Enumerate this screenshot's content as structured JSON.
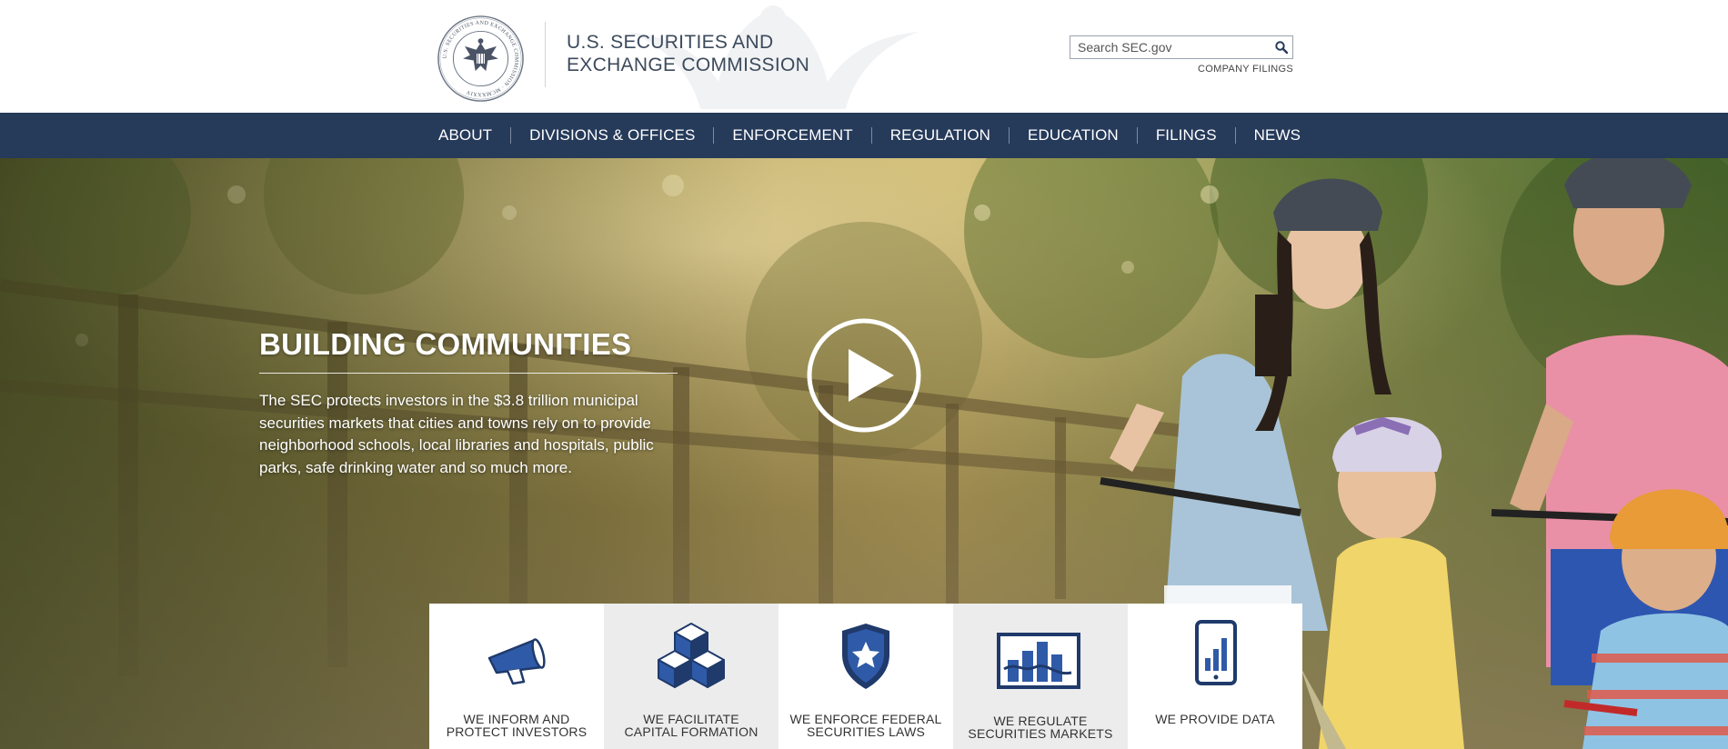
{
  "header": {
    "seal_text": "U.S. SECURITIES AND EXCHANGE COMMISSION · MCMXXXIV",
    "agency_name": "U.S. SECURITIES AND EXCHANGE COMMISSION",
    "search": {
      "placeholder": "Search SEC.gov",
      "value": ""
    },
    "company_filings_label": "COMPANY FILINGS"
  },
  "nav": {
    "items": [
      {
        "label": "ABOUT"
      },
      {
        "label": "DIVISIONS & OFFICES"
      },
      {
        "label": "ENFORCEMENT"
      },
      {
        "label": "REGULATION"
      },
      {
        "label": "EDUCATION"
      },
      {
        "label": "FILINGS"
      },
      {
        "label": "NEWS"
      }
    ]
  },
  "hero": {
    "title": "BUILDING COMMUNITIES",
    "body": "The SEC protects investors in the $3.8 trillion municipal securities markets that cities and towns rely on to provide neighborhood schools, local libraries and hospitals, public parks, safe drinking water and so much more."
  },
  "tiles": [
    {
      "label": "WE INFORM AND\nPROTECT INVESTORS",
      "icon": "megaphone-icon"
    },
    {
      "label": "WE FACILITATE\nCAPITAL FORMATION",
      "icon": "cubes-icon"
    },
    {
      "label": "WE ENFORCE FEDERAL\nSECURITIES LAWS",
      "icon": "shield-star-icon"
    },
    {
      "label": "WE REGULATE\nSECURITIES MARKETS",
      "icon": "market-chart-icon"
    },
    {
      "label": "WE PROVIDE DATA",
      "icon": "mobile-data-icon"
    }
  ],
  "colors": {
    "nav_background": "#263a5a",
    "icon_blue": "#2f5aa8",
    "icon_navy": "#1f3a6b",
    "agency_text": "#3d4a5c"
  }
}
